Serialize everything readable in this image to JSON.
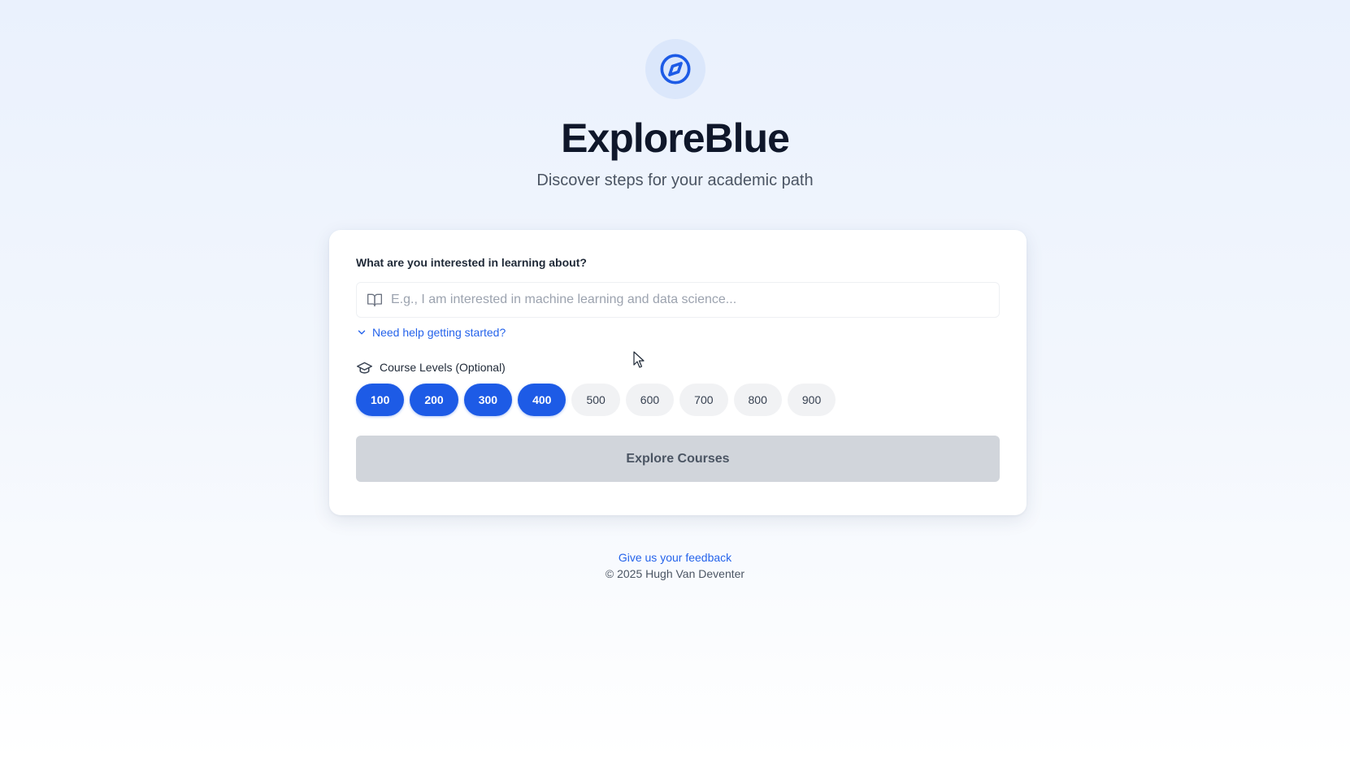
{
  "app": {
    "title": "ExploreBlue",
    "subtitle": "Discover steps for your academic path",
    "logo_icon": "compass-icon"
  },
  "form": {
    "question_label": "What are you interested in learning about?",
    "input_placeholder": "E.g., I am interested in machine learning and data science...",
    "input_value": "",
    "input_icon": "book-open-icon",
    "help_link": "Need help getting started?",
    "help_icon": "chevron-down-icon",
    "levels_label": "Course Levels (Optional)",
    "levels_icon": "graduation-cap-icon",
    "levels": [
      {
        "label": "100",
        "selected": true
      },
      {
        "label": "200",
        "selected": true
      },
      {
        "label": "300",
        "selected": true
      },
      {
        "label": "400",
        "selected": true
      },
      {
        "label": "500",
        "selected": false
      },
      {
        "label": "600",
        "selected": false
      },
      {
        "label": "700",
        "selected": false
      },
      {
        "label": "800",
        "selected": false
      },
      {
        "label": "900",
        "selected": false
      }
    ],
    "submit_label": "Explore Courses",
    "submit_disabled": true
  },
  "footer": {
    "feedback_link": "Give us your feedback",
    "copyright": "© 2025 Hugh Van Deventer"
  },
  "colors": {
    "accent": "#1d5be6",
    "link": "#2563eb",
    "disabled_button": "#d1d5db",
    "logo_bg": "#dbe7fb"
  }
}
